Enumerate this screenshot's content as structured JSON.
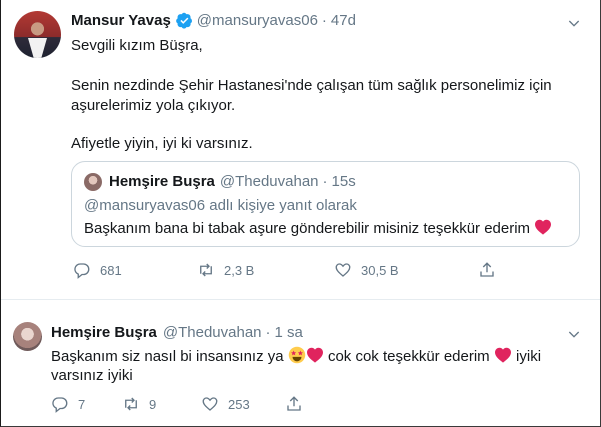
{
  "tweet_main": {
    "name": "Mansur Yavaş",
    "handle": "@mansuryavas06",
    "separator": "·",
    "time": "47d",
    "lines": [
      "Sevgili kızım Büşra,",
      "Senin nezdinde Şehir Hastanesi'nde çalışan tüm sağlık personelimiz için",
      "aşurelerimiz yola çıkıyor.",
      "Afiyetle yiyin, iyi ki varsınız."
    ],
    "quote": {
      "name": "Hemşire Buşra",
      "handle": "@Theduvahan",
      "separator": "·",
      "time": "15s",
      "reply_to": "@mansuryavas06 adlı kişiye yanıt olarak",
      "text": "Başkanım bana bi tabak aşure gönderebilir misiniz teşekkür ederim"
    },
    "actions": {
      "replies": "681",
      "retweets": "2,3 B",
      "likes": "30,5 B"
    }
  },
  "tweet_reply": {
    "name": "Hemşire Buşra",
    "handle": "@Theduvahan",
    "separator": "·",
    "time": "1 sa",
    "text_part1": "Başkanım siz nasıl bi insansınız ya",
    "text_part2": "cok cok teşekkür ederim",
    "text_part3": "iyiki",
    "text_line2": "varsınız iyiki",
    "actions": {
      "replies": "7",
      "retweets": "9",
      "likes": "253"
    }
  },
  "colors": {
    "accent": "#1da1f2",
    "text": "#14171a",
    "muted": "#657786",
    "heart": "#e0245e",
    "border": "#e6ecf0"
  },
  "icons": [
    "verified-badge-icon",
    "chevron-down-icon",
    "reply-icon",
    "retweet-icon",
    "like-icon",
    "share-icon",
    "red-heart-emoji",
    "star-struck-emoji"
  ]
}
